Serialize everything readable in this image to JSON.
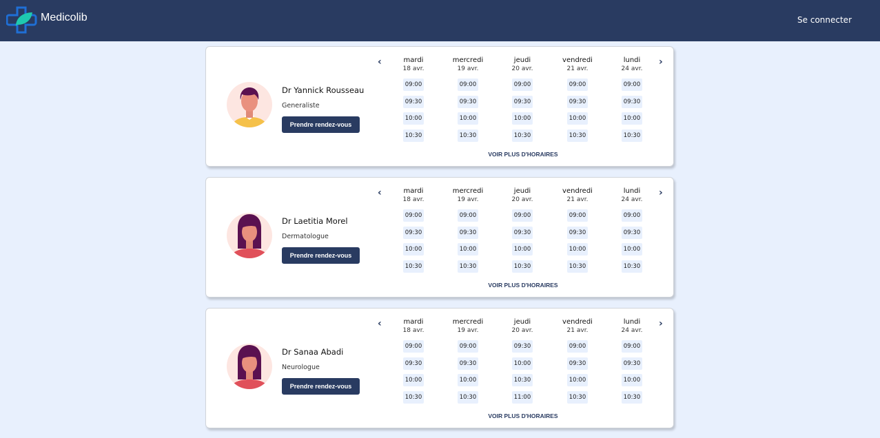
{
  "header": {
    "brand": "Medicolib",
    "login": "Se connecter"
  },
  "colors": {
    "header": "#293b61",
    "background": "#e8f0fd",
    "slot": "#e8f0fd"
  },
  "days": [
    {
      "day": "mardi",
      "date": "18 avr."
    },
    {
      "day": "mercredi",
      "date": "19 avr."
    },
    {
      "day": "jeudi",
      "date": "20 avr."
    },
    {
      "day": "vendredi",
      "date": "21 avr."
    },
    {
      "day": "lundi",
      "date": "24 avr."
    }
  ],
  "doctors": [
    {
      "name": "Dr Yannick Rousseau",
      "specialty": "Generaliste",
      "avatar": "male",
      "book": "Prendre rendez-vous",
      "more": "VOIR PLUS D'HORAIRES",
      "slots": [
        [
          "09:00",
          "09:30",
          "10:00",
          "10:30"
        ],
        [
          "09:00",
          "09:30",
          "10:00",
          "10:30"
        ],
        [
          "09:00",
          "09:30",
          "10:00",
          "10:30"
        ],
        [
          "09:00",
          "09:30",
          "10:00",
          "10:30"
        ],
        [
          "09:00",
          "09:30",
          "10:00",
          "10:30"
        ]
      ]
    },
    {
      "name": "Dr Laetitia Morel",
      "specialty": "Dermatologue",
      "avatar": "female",
      "book": "Prendre rendez-vous",
      "more": "VOIR PLUS D'HORAIRES",
      "slots": [
        [
          "09:00",
          "09:30",
          "10:00",
          "10:30"
        ],
        [
          "09:00",
          "09:30",
          "10:00",
          "10:30"
        ],
        [
          "09:00",
          "09:30",
          "10:00",
          "10:30"
        ],
        [
          "09:00",
          "09:30",
          "10:00",
          "10:30"
        ],
        [
          "09:00",
          "09:30",
          "10:00",
          "10:30"
        ]
      ]
    },
    {
      "name": "Dr Sanaa Abadi",
      "specialty": "Neurologue",
      "avatar": "female",
      "book": "Prendre rendez-vous",
      "more": "VOIR PLUS D'HORAIRES",
      "slots": [
        [
          "09:00",
          "09:30",
          "10:00",
          "10:30"
        ],
        [
          "09:00",
          "09:30",
          "10:00",
          "10:30"
        ],
        [
          "09:30",
          "10:00",
          "10:30",
          "11:00"
        ],
        [
          "09:00",
          "09:30",
          "10:00",
          "10:30"
        ],
        [
          "09:00",
          "09:30",
          "10:00",
          "10:30"
        ]
      ]
    }
  ]
}
